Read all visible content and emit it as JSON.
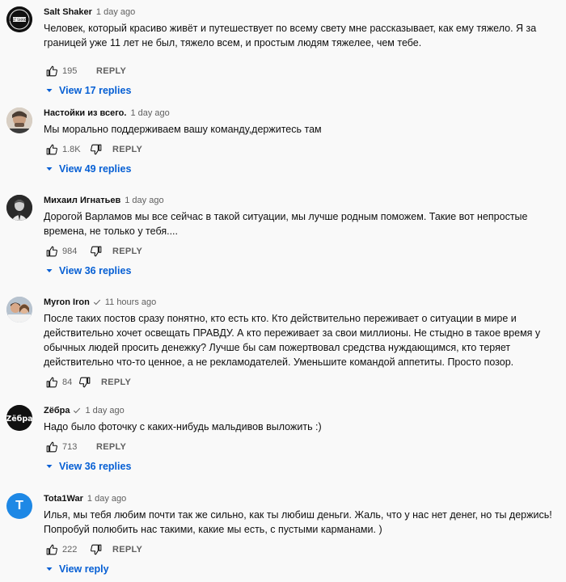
{
  "comments": [
    {
      "author": "Salt Shaker",
      "time": "1 day ago",
      "text": "Человек, который красиво живёт и путешествует по всему свету мне рассказывает, как ему тяжело. Я за границей уже 11 лет не был, тяжело всем, и простым людям тяжелее, чем тебе.",
      "likes": "195",
      "reply_label": "REPLY",
      "replies_label": "View 17 replies"
    },
    {
      "author": "Настойки из всего.",
      "time": "1 day ago",
      "text": "Мы морально поддерживаем вашу команду,держитесь там",
      "likes": "1.8K",
      "reply_label": "REPLY",
      "replies_label": "View 49 replies"
    },
    {
      "author": "Михаил Игнатьев",
      "time": "1 day ago",
      "text": "Дорогой Варламов мы все сейчас в такой ситуации, мы лучше родным поможем.  Такие вот непростые времена, не только у тебя....",
      "likes": "984",
      "reply_label": "REPLY",
      "replies_label": "View 36 replies"
    },
    {
      "author": "Myron Iron",
      "time": "11 hours ago",
      "text": "После таких постов сразу понятно, кто есть кто. Кто действительно переживает о ситуации в мире и действительно хочет освещать ПРАВДУ. А кто переживает за свои миллионы. Не стыдно в такое время у обычных людей просить денежку? Лучше бы сам пожертвовал средства нуждающимся, кто теряет действительно что-то ценное, а не рекламодателей. Уменьшите командой аппетиты. Просто позор.",
      "likes": "84",
      "reply_label": "REPLY",
      "replies_label": ""
    },
    {
      "author": "Zёбра",
      "time": "1 day ago",
      "text": "Надо было фоточку с каких-нибудь мальдивов выложить :)",
      "likes": "713",
      "reply_label": "REPLY",
      "replies_label": "View 36 replies"
    },
    {
      "author": "Tota1War",
      "time": "1 day ago",
      "text": "Илья, мы тебя любим почти так же сильно, как ты любиш деньги. Жаль, что у нас нет денег, но ты держись! Попробуй полюбить нас такими, какие мы есть, с пустыми карманами. )",
      "likes": "222",
      "reply_label": "REPLY",
      "replies_label": "View reply"
    }
  ],
  "avatars": {
    "salt_shaker": "SALT SHAKER",
    "zebra": "Zёбра",
    "tota1war": "T"
  },
  "colors": {
    "link": "#065fd4",
    "muted": "#606060",
    "tota_avatar": "#1e88e5"
  }
}
